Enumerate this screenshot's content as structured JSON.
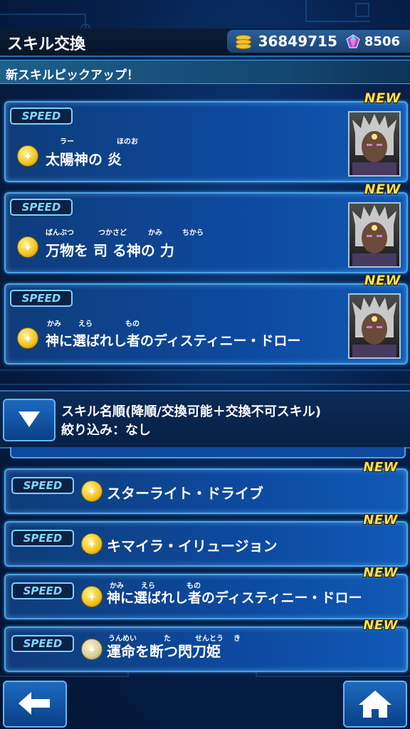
{
  "header": {
    "title": "スキル交換",
    "coins": "36849715",
    "gems": "8506"
  },
  "pickup": {
    "label": "新スキルピックアップ！"
  },
  "featured": [
    {
      "badge": "SPEED",
      "new_label": "NEW",
      "name": "太陽神の 炎",
      "ruby": [
        {
          "text": "ラー"
        },
        {
          "text": "ほのお"
        }
      ]
    },
    {
      "badge": "SPEED",
      "new_label": "NEW",
      "name": "万物を 司 る神の 力",
      "ruby": [
        {
          "text": "ばんぶつ"
        },
        {
          "text": "つかさど"
        },
        {
          "text": "かみ"
        },
        {
          "text": "ちから"
        }
      ]
    },
    {
      "badge": "SPEED",
      "new_label": "NEW",
      "name": "神に選ばれし者のディスティニー・ドロー",
      "ruby": [
        {
          "text": "かみ"
        },
        {
          "text": "えら"
        },
        {
          "text": "もの"
        }
      ]
    }
  ],
  "sort": {
    "line1": "スキル名順(降順/交換可能＋交換不可スキル)",
    "line2": "絞り込み：なし"
  },
  "list": [
    {
      "badge": "SPEED",
      "new_label": "NEW",
      "name": "スターライト・ドライブ",
      "ruby": []
    },
    {
      "badge": "SPEED",
      "new_label": "NEW",
      "name": "キマイラ・イリュージョン",
      "ruby": []
    },
    {
      "badge": "SPEED",
      "new_label": "NEW",
      "name": "神に選ばれし者のディスティニー・ドロー",
      "ruby": [
        {
          "text": "かみ"
        },
        {
          "text": "えら"
        },
        {
          "text": "もの"
        }
      ]
    },
    {
      "badge": "SPEED",
      "new_label": "NEW",
      "name": "運命を断つ閃刀姫",
      "ruby": [
        {
          "text": "うんめい"
        },
        {
          "text": "た"
        },
        {
          "text": "せんとう"
        },
        {
          "text": "き"
        }
      ]
    }
  ],
  "colors": {
    "accent": "#4aa3e6",
    "new": "#f6df55",
    "star": "#f0c21f"
  },
  "icons": {
    "back": "arrow-left-icon",
    "home": "home-icon",
    "sort": "triangle-down-icon"
  }
}
